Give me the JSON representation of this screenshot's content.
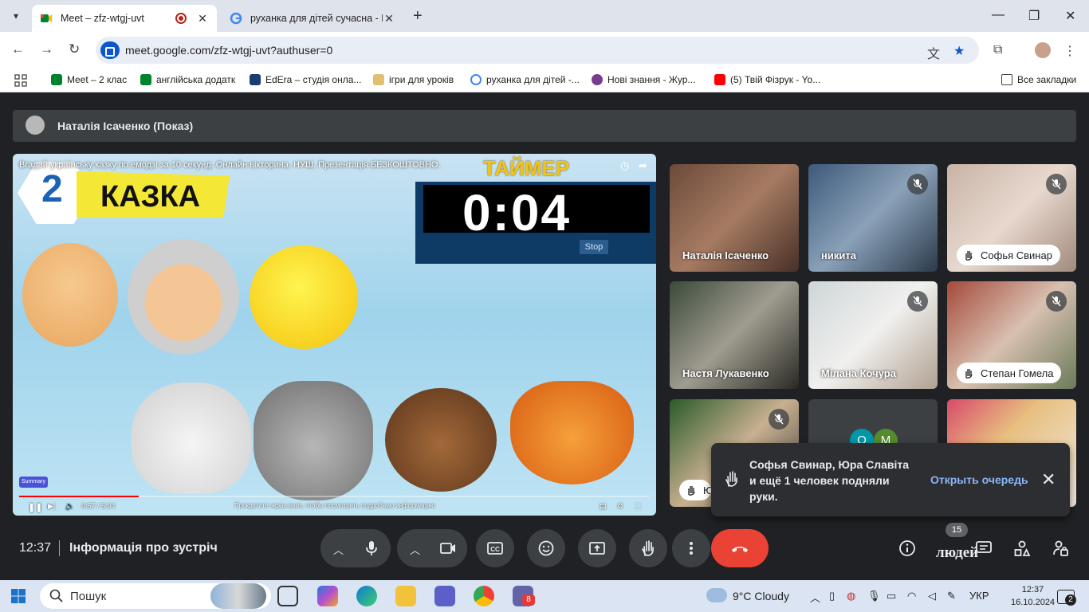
{
  "browser": {
    "tabs": [
      {
        "title": "Meet – zfz-wtgj-uvt",
        "active": true
      },
      {
        "title": "руханка для дітей сучасна - По",
        "active": false
      }
    ],
    "url": "meet.google.com/zfz-wtgj-uvt?authuser=0",
    "bookmarks": [
      {
        "label": "Meet – 2 клас"
      },
      {
        "label": "англійська додатк"
      },
      {
        "label": "EdEra – студія онла..."
      },
      {
        "label": "ігри для уроків"
      },
      {
        "label": "руханка для дітей -..."
      },
      {
        "label": "Нові знання - Жур..."
      },
      {
        "label": "(5) Твій Фізрук - Yo..."
      }
    ],
    "all_bookmarks": "Все закладки"
  },
  "meet": {
    "presenter": "Наталія Ісаченко (Показ)",
    "video": {
      "title": "Вгадай українську казку по емодзі за 10 секунд. Онлайн вікторина. НУШ. Презентація БЕЗКОШТОВНО.",
      "number": "2",
      "banner": "КАЗКА",
      "timer_label": "ТАЙМЕР",
      "timer_value": "0:04",
      "stop_label": "Stop",
      "summary_label": "Summary",
      "time_display": "0:57 / 5:04",
      "scroll_hint": "Прокрутите экран вниз, чтобы посмотреть подробную информацию",
      "progress_fraction": 0.19
    },
    "participants": [
      {
        "name": "Наталія Ісаченко",
        "muted": false,
        "hand_raised": false
      },
      {
        "name": "никита",
        "muted": true,
        "hand_raised": false
      },
      {
        "name": "Софья Свинар",
        "muted": true,
        "hand_raised": true
      },
      {
        "name": "Настя Лукавенко",
        "muted": false,
        "hand_raised": false
      },
      {
        "name": "Мілана Кочура",
        "muted": true,
        "hand_raised": false
      },
      {
        "name": "Степан Гомела",
        "muted": true,
        "hand_raised": true
      },
      {
        "name": "Ю",
        "muted": true,
        "hand_raised": true
      }
    ],
    "overflow_tile_initials": [
      "О",
      "М"
    ],
    "notification": {
      "text": "Софья Свинар, Юра Славіта и ещё 1 человек подняли руки.",
      "link": "Открыть очередь"
    },
    "clock": "12:37",
    "meeting_info": "Інформація про зустріч",
    "people_count": "15",
    "people_word": "людей"
  },
  "taskbar": {
    "search_placeholder": "Пошук",
    "teams_badge": "8",
    "weather": "9°C  Cloudy",
    "lang": "УКР",
    "time": "12:37",
    "date": "16.10.2024",
    "notif_count": "2"
  },
  "colors": {
    "meet_bg": "#202124",
    "end_call": "#ea4335",
    "link": "#8ab4f8",
    "taskbar": "#dbe4f2"
  }
}
